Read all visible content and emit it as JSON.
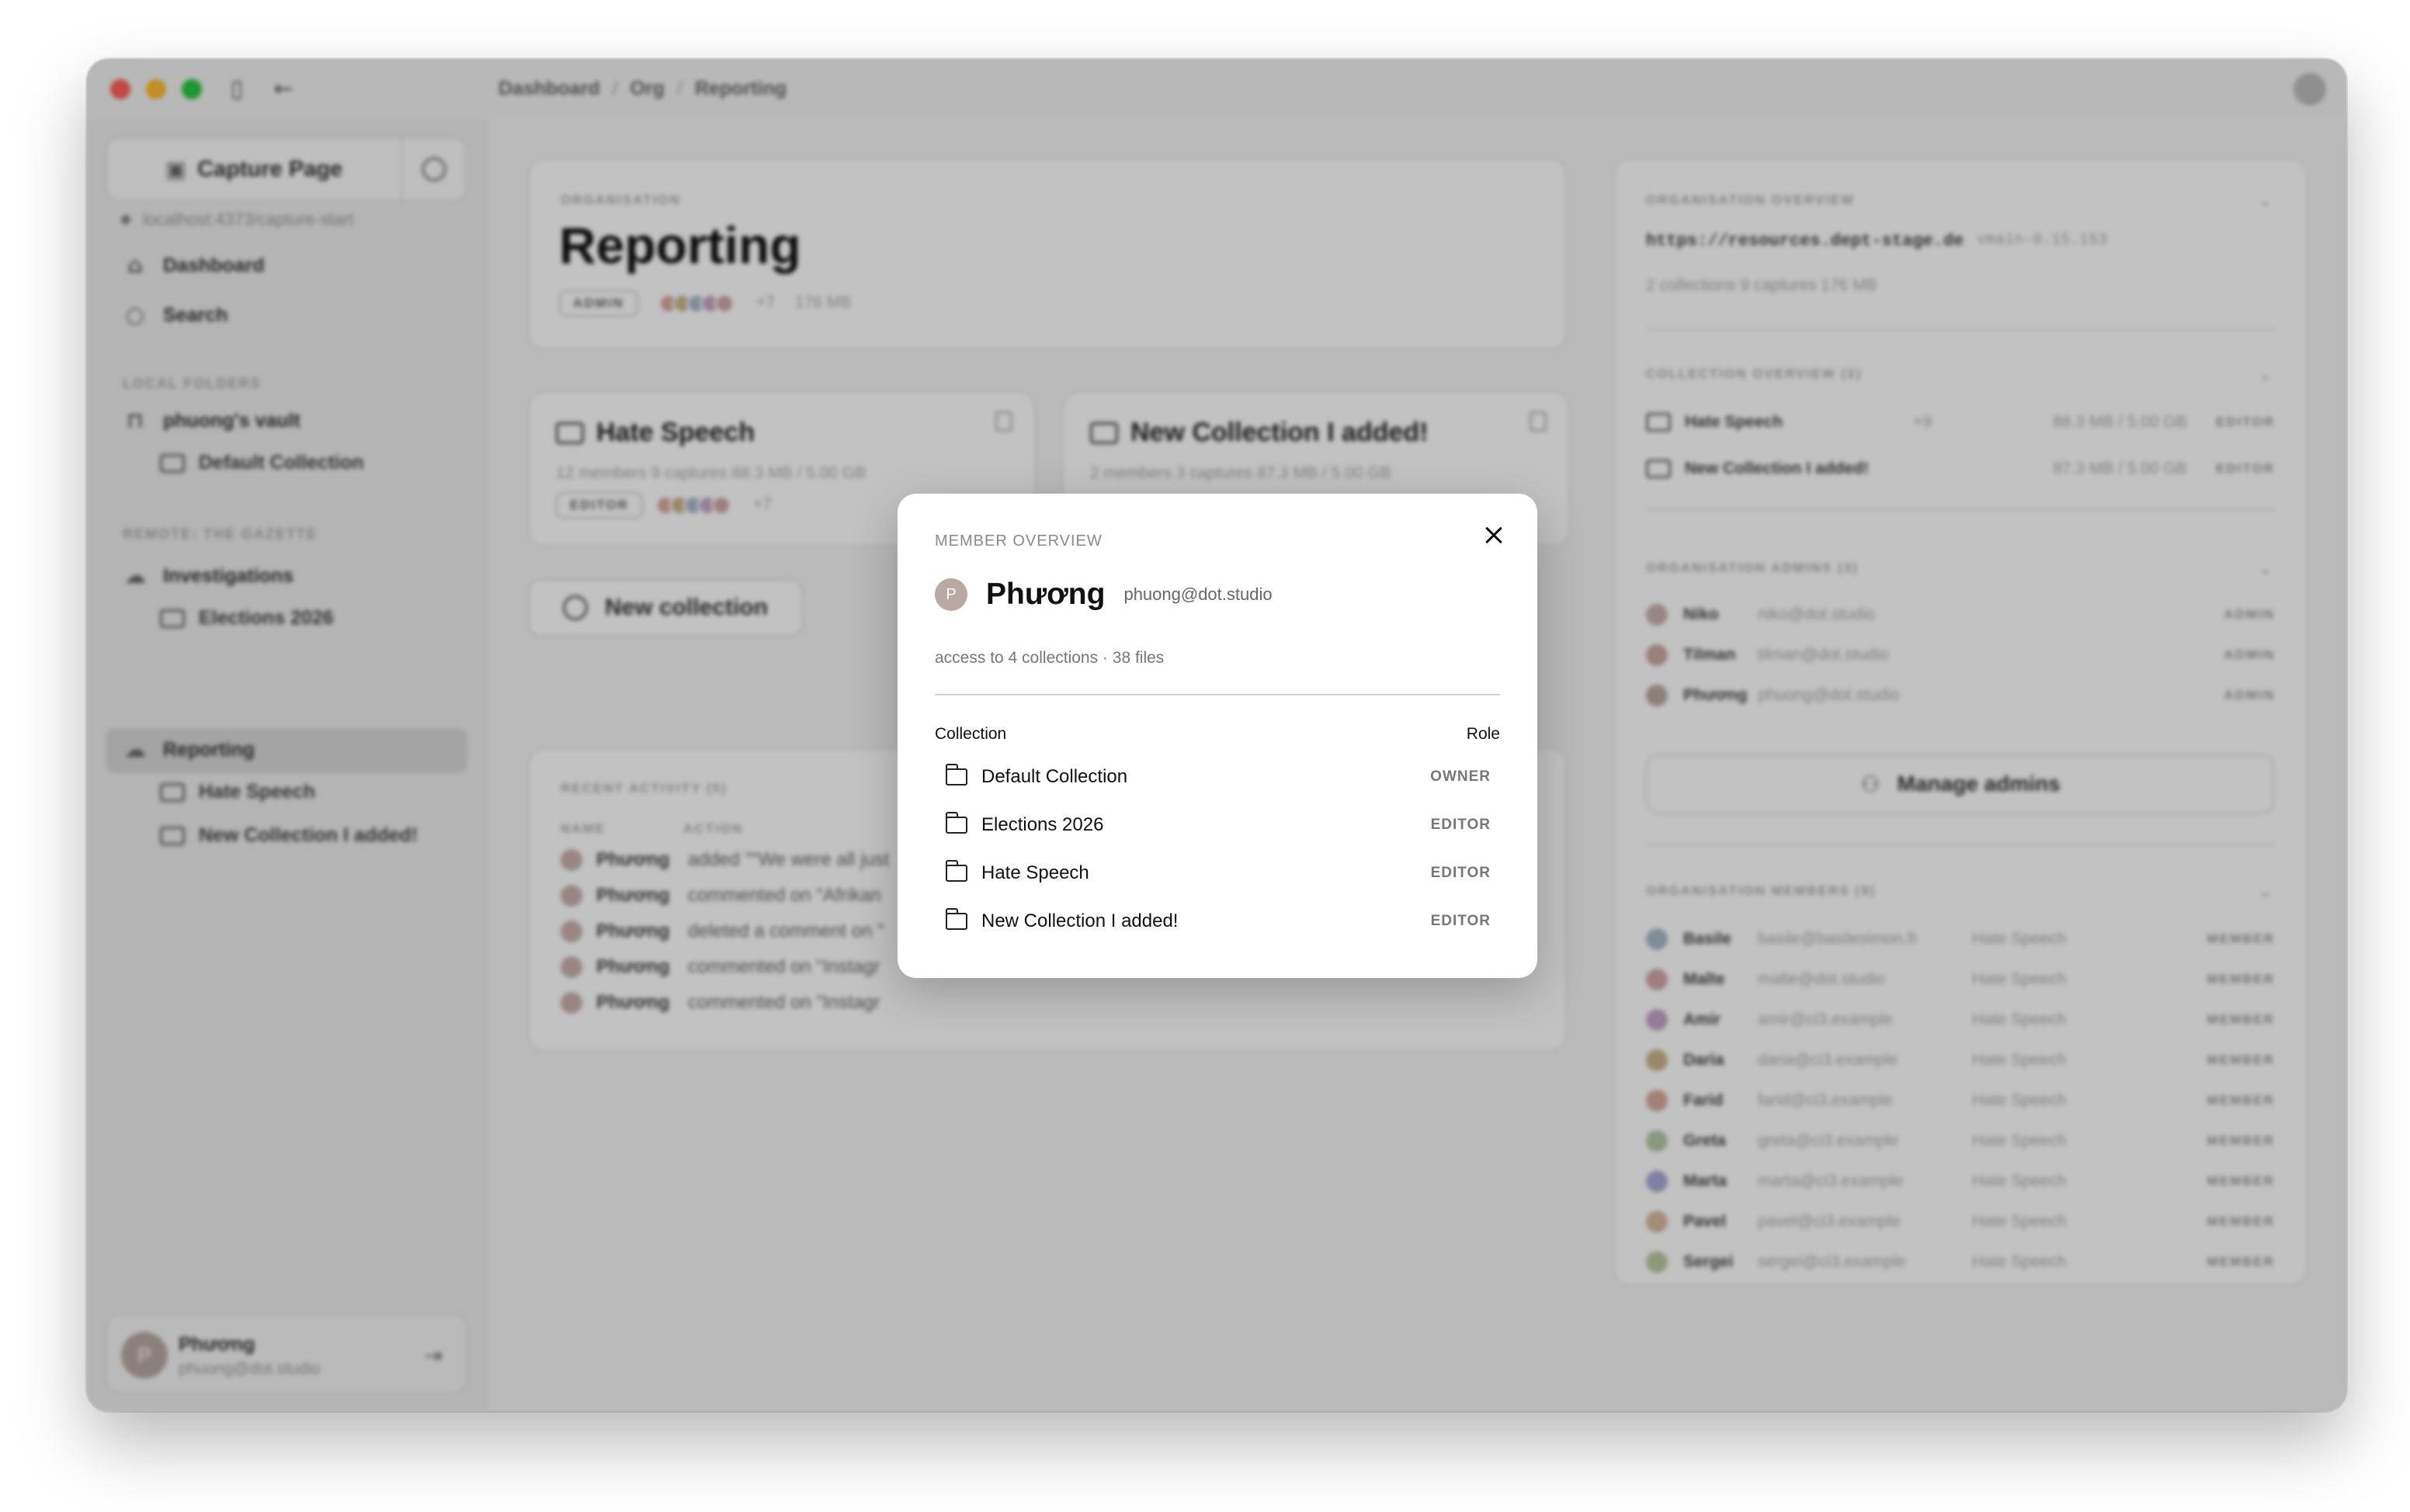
{
  "window": {
    "breadcrumb": [
      "Dashboard",
      "Org",
      "Reporting"
    ],
    "icons": {
      "sidebar_toggle": "sidebar-icon",
      "back": "arrow-left-icon",
      "settings": "gear-icon"
    }
  },
  "sidebar": {
    "capture_label": "Capture Page",
    "capture_url": "localhost:4373/capture-start",
    "nav": [
      {
        "label": "Dashboard",
        "icon": "home-icon"
      },
      {
        "label": "Search",
        "icon": "search-icon"
      }
    ],
    "local_section": "LOCAL FOLDERS",
    "vault": "phuong's vault",
    "vault_child": "Default Collection",
    "remote_section": "REMOTE: THE GAZETTE",
    "remote_items": [
      {
        "label": "Investigations",
        "children": [
          "Elections 2026"
        ]
      },
      {
        "label": "Reporting",
        "children": [
          "Hate Speech",
          "New Collection I added!"
        ]
      }
    ],
    "user": {
      "initial": "P",
      "name": "Phương",
      "email": "phuong@dot.studio"
    }
  },
  "org": {
    "label": "ORGANISATION",
    "title": "Reporting",
    "role": "ADMIN",
    "more": "+7",
    "size": "176 MB"
  },
  "collections": [
    {
      "title": "Hate Speech",
      "meta": "12 members  9 captures  88.3 MB / 5.00 GB",
      "role": "EDITOR",
      "more": "+7"
    },
    {
      "title": "New Collection I added!",
      "meta": "2 members  3 captures  87.3 MB / 5.00 GB"
    }
  ],
  "new_collection_label": "New collection",
  "activity": {
    "label": "RECENT ACTIVITY (5)",
    "col_name": "NAME",
    "col_action": "ACTION",
    "rows": [
      {
        "name": "Phương",
        "action": "added \"\"We were all just"
      },
      {
        "name": "Phương",
        "action": "commented on \"Afrikan"
      },
      {
        "name": "Phương",
        "action": "deleted a comment on \""
      },
      {
        "name": "Phương",
        "action": "commented on \"Instagr"
      },
      {
        "name": "Phương",
        "action": "commented on \"Instagr"
      }
    ]
  },
  "right": {
    "org_overview": "ORGANISATION OVERVIEW",
    "url": "https://resources.dept-stage.de",
    "version": "vmain-0.15.153",
    "stats": "2 collections  9 captures  176 MB",
    "coll_overview": "COLLECTION OVERVIEW (2)",
    "coll_rows": [
      {
        "name": "Hate Speech",
        "more": "+9",
        "size": "88.3 MB / 5.00 GB",
        "role": "EDITOR"
      },
      {
        "name": "New Collection I added!",
        "size": "87.3 MB / 5.00 GB",
        "role": "EDITOR"
      }
    ],
    "admins_label": "ORGANISATION ADMINS (3)",
    "admins": [
      {
        "name": "Niko",
        "email": "niko@dot.studio",
        "role": "ADMIN"
      },
      {
        "name": "Tilman",
        "email": "tilman@dot.studio",
        "role": "ADMIN"
      },
      {
        "name": "Phương",
        "email": "phuong@dot.studio",
        "role": "ADMIN"
      }
    ],
    "manage_label": "Manage admins",
    "members_label": "ORGANISATION MEMBERS (9)",
    "members": [
      {
        "name": "Basile",
        "email": "basile@basilesimon.fr",
        "coll": "Hate Speech",
        "role": "MEMBER"
      },
      {
        "name": "Malte",
        "email": "malte@dot.studio",
        "coll": "Hate Speech",
        "role": "MEMBER"
      },
      {
        "name": "Amir",
        "email": "amir@ci3.example",
        "coll": "Hate Speech",
        "role": "MEMBER"
      },
      {
        "name": "Daria",
        "email": "daria@ci3.example",
        "coll": "Hate Speech",
        "role": "MEMBER"
      },
      {
        "name": "Farid",
        "email": "farid@ci3.example",
        "coll": "Hate Speech",
        "role": "MEMBER"
      },
      {
        "name": "Greta",
        "email": "greta@ci3.example",
        "coll": "Hate Speech",
        "role": "MEMBER"
      },
      {
        "name": "Marta",
        "email": "marta@ci3.example",
        "coll": "Hate Speech",
        "role": "MEMBER"
      },
      {
        "name": "Pavel",
        "email": "pavel@ci3.example",
        "coll": "Hate Speech",
        "role": "MEMBER"
      },
      {
        "name": "Sergei",
        "email": "sergei@ci3.example",
        "coll": "Hate Speech",
        "role": "MEMBER"
      }
    ]
  },
  "modal": {
    "label": "MEMBER OVERVIEW",
    "initial": "P",
    "name": "Phương",
    "email": "phuong@dot.studio",
    "stats": "access to 4 collections · 38 files",
    "col_collection": "Collection",
    "col_role": "Role",
    "rows": [
      {
        "name": "Default Collection",
        "role": "OWNER"
      },
      {
        "name": "Elections 2026",
        "role": "EDITOR"
      },
      {
        "name": "Hate Speech",
        "role": "EDITOR"
      },
      {
        "name": "New Collection I added!",
        "role": "EDITOR"
      }
    ],
    "close_icon": "close-icon"
  },
  "colors": {
    "avatar": "#b9a9a3",
    "overlay": "rgba(0,0,0,0.24)",
    "traffic": [
      "#ff5f57",
      "#febc2e",
      "#28c840"
    ]
  }
}
